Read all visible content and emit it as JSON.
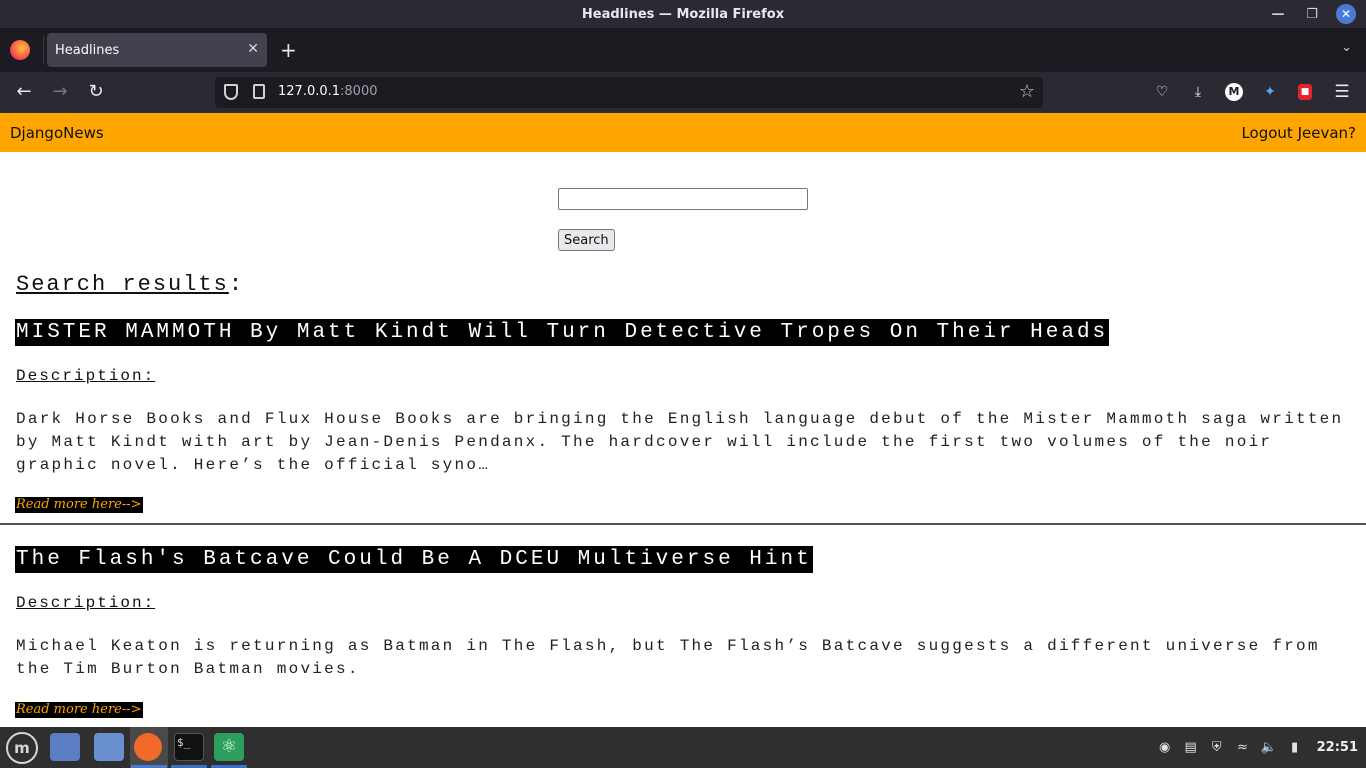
{
  "window": {
    "title": "Headlines — Mozilla Firefox"
  },
  "browser": {
    "tab_title": "Headlines",
    "url_host": "127.0.0.1",
    "url_port": ":8000"
  },
  "site": {
    "brand": "DjangoNews",
    "logout": "Logout Jeevan?"
  },
  "search": {
    "value": "",
    "placeholder": "",
    "button_label": "Search"
  },
  "results": {
    "heading": "Search results",
    "heading_suffix": ":",
    "articles": [
      {
        "title": "MISTER MAMMOTH By Matt Kindt Will Turn Detective Tropes On Their Heads",
        "description_label": "Description:",
        "description": "Dark Horse Books and Flux House Books are bringing the English language debut of the Mister Mammoth saga written by Matt Kindt with art by Jean-Denis Pendanx. The hardcover will include the first two volumes of the noir graphic novel. Here’s the official syno…",
        "read_more": "Read more here-->"
      },
      {
        "title": "The Flash's Batcave Could Be A DCEU Multiverse Hint",
        "description_label": "Description:",
        "description": "Michael Keaton is returning as Batman in The Flash, but The Flash’s Batcave suggests a different universe from the Tim Burton Batman movies.",
        "read_more": "Read more here-->"
      }
    ]
  },
  "taskbar": {
    "clock": "22:51"
  },
  "colors": {
    "nav_bar": "#ffa500",
    "title_bg": "#000000",
    "read_more_text": "#ffa500"
  }
}
